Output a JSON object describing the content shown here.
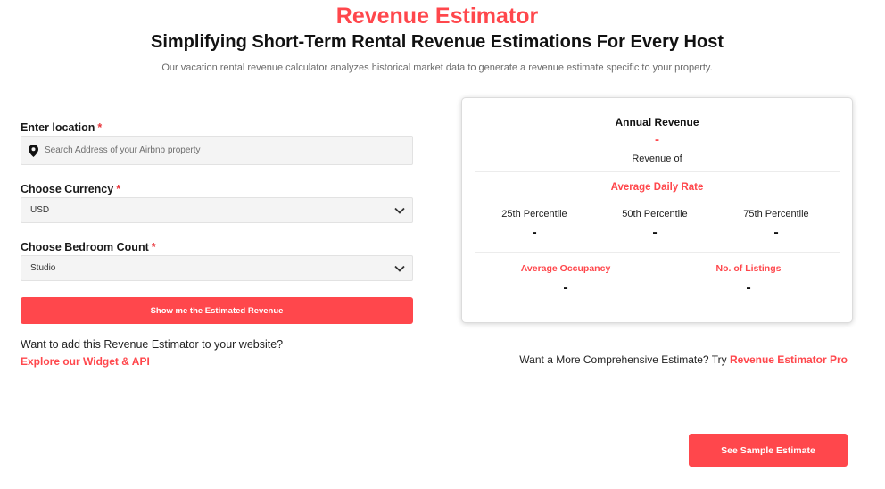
{
  "header": {
    "title": "Revenue Estimator",
    "subtitle": "Simplifying Short-Term Rental Revenue Estimations For Every Host",
    "description": "Our vacation rental revenue calculator analyzes historical market data to generate a revenue estimate specific to your property."
  },
  "form": {
    "location": {
      "label": "Enter location",
      "required_mark": "*",
      "placeholder": "Search Address of your Airbnb property",
      "value": ""
    },
    "currency": {
      "label": "Choose Currency",
      "required_mark": "*",
      "selected": "USD"
    },
    "bedrooms": {
      "label": "Choose Bedroom Count",
      "required_mark": "*",
      "selected": "Studio"
    },
    "submit_label": "Show me the Estimated Revenue"
  },
  "promo": {
    "question": "Want to add this Revenue Estimator to your website?",
    "link": "Explore our Widget & API"
  },
  "results": {
    "annual_revenue_label": "Annual Revenue",
    "annual_revenue_value": "-",
    "revenue_of_label": "Revenue of",
    "adr_label": "Average Daily Rate",
    "percentiles": [
      {
        "label": "25th Percentile",
        "value": "-"
      },
      {
        "label": "50th Percentile",
        "value": "-"
      },
      {
        "label": "75th Percentile",
        "value": "-"
      }
    ],
    "occupancy_label": "Average Occupancy",
    "occupancy_value": "-",
    "listings_label": "No. of Listings",
    "listings_value": "-"
  },
  "more": {
    "text": "Want a More Comprehensive Estimate? Try",
    "link": "Revenue Estimator Pro"
  },
  "sample_button_label": "See Sample Estimate",
  "icons": {
    "location": "map-pin-icon",
    "dropdown": "chevron-down-icon"
  },
  "colors": {
    "accent": "#ff474c",
    "input_bg": "#f4f4f4"
  }
}
